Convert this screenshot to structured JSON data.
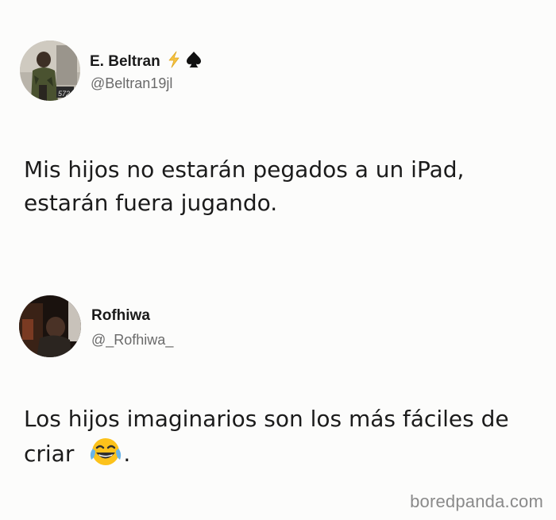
{
  "tweets": [
    {
      "display_name": "E. Beltran",
      "handle": "@Beltran19jl",
      "badges": [
        "lightning-icon",
        "spade-icon"
      ],
      "text_lines": [
        "Mis hijos no estarán pegados a un iPad,",
        "estarán fuera jugando."
      ]
    },
    {
      "display_name": "Rofhiwa",
      "handle": "@_Rofhiwa_",
      "text_lines": [
        "Los hijos imaginarios son los más fáciles de",
        "criar"
      ],
      "trailing_emoji": "tears-of-joy-emoji",
      "trailing_text": "."
    }
  ],
  "watermark": "boredpanda.com",
  "colors": {
    "background": "#fcfcfb",
    "text": "#1b1b1b",
    "handle": "#6a6a6a",
    "lightning": "#f5c242",
    "watermark": "#8a8a8a"
  }
}
